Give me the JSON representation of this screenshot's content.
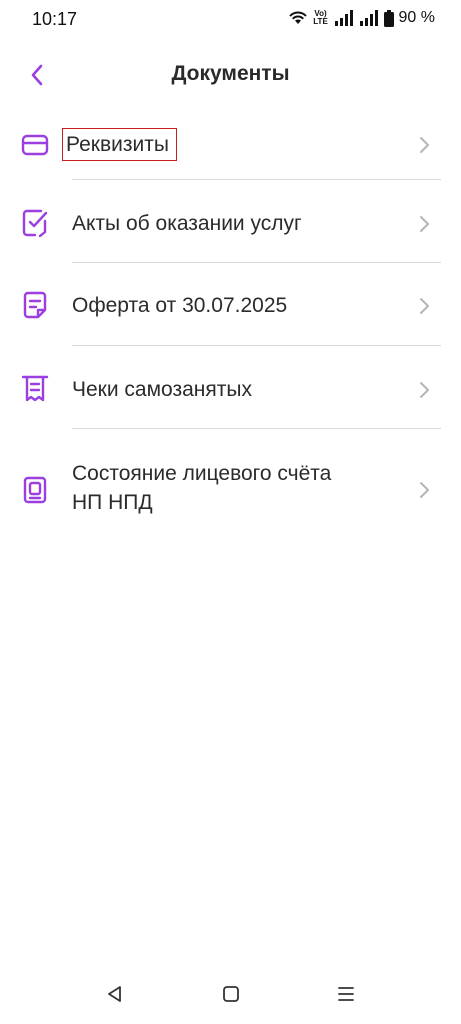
{
  "status_bar": {
    "time": "10:17",
    "network_label": "Vo) LTE",
    "battery": "90 %"
  },
  "header": {
    "title": "Документы"
  },
  "menu": {
    "items": [
      {
        "label": "Реквизиты",
        "icon": "card-icon"
      },
      {
        "label": "Акты об оказании услуг",
        "icon": "signed-document-icon"
      },
      {
        "label": "Оферта от 30.07.2025",
        "icon": "document-icon"
      },
      {
        "label": "Чеки самозанятых",
        "icon": "receipt-icon"
      },
      {
        "label": "Состояние лицевого счёта\nНП НПД",
        "icon": "account-statement-icon"
      }
    ]
  },
  "nav_bar": {
    "icons": [
      "back-triangle-icon",
      "home-square-icon",
      "menu-lines-icon"
    ]
  },
  "colors": {
    "accent": "#9b3fe0",
    "highlight": "#c81e1e"
  }
}
